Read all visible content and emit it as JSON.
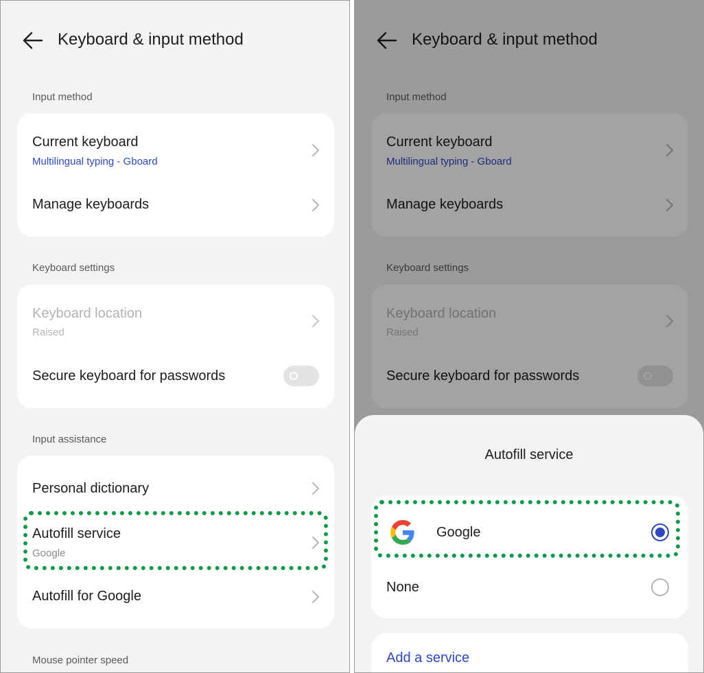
{
  "header": {
    "title": "Keyboard & input method"
  },
  "sections": {
    "input_method": "Input method",
    "keyboard_settings": "Keyboard settings",
    "input_assistance": "Input assistance",
    "mouse_pointer": "Mouse pointer speed"
  },
  "input_method": {
    "current_keyboard": {
      "title": "Current keyboard",
      "value": "Multilingual typing - Gboard"
    },
    "manage_keyboards": {
      "title": "Manage keyboards"
    }
  },
  "keyboard_settings": {
    "keyboard_location": {
      "title": "Keyboard location",
      "value": "Raised",
      "enabled": false
    },
    "secure_keyboard": {
      "title": "Secure keyboard for passwords",
      "on": false
    }
  },
  "input_assistance": {
    "personal_dictionary": {
      "title": "Personal dictionary"
    },
    "autofill_service": {
      "title": "Autofill service",
      "value": "Google"
    },
    "autofill_for_google": {
      "title": "Autofill for Google"
    }
  },
  "autofill_sheet": {
    "title": "Autofill service",
    "options": [
      {
        "label": "Google",
        "selected": true,
        "icon": "google-logo-icon"
      },
      {
        "label": "None",
        "selected": false
      }
    ],
    "add_service": "Add a service"
  },
  "colors": {
    "accent": "#2e47c2",
    "highlight": "#0a9a4a",
    "background": "#f3f3f3",
    "card": "#ffffff"
  }
}
